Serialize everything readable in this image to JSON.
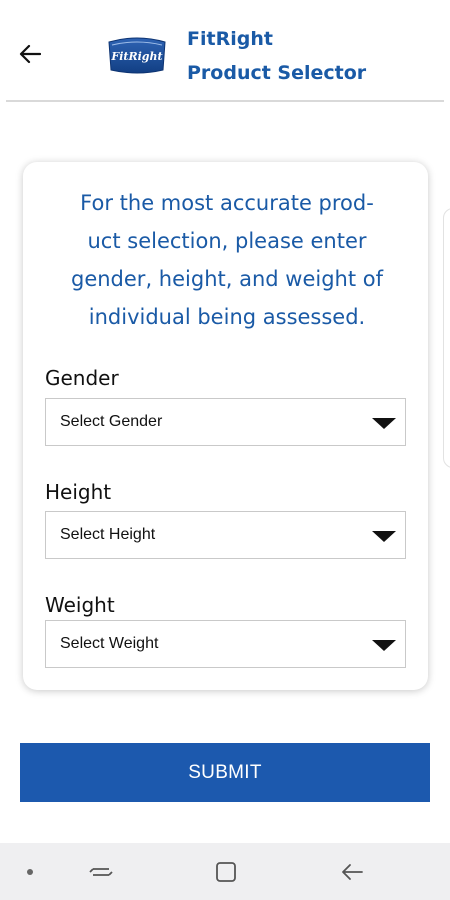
{
  "header": {
    "title_line1": "FitRight",
    "title_line2": "Product Selector",
    "logo_text": "FitRight",
    "back_icon": "arrow-left-icon"
  },
  "card": {
    "intro_line1": "For the most accurate prod-",
    "intro_line2": "uct selection, please enter",
    "intro_line3": "gender, height, and weight of",
    "intro_line4": "individual being assessed.",
    "fields": [
      {
        "label": "Gender",
        "value": "Select Gender"
      },
      {
        "label": "Height",
        "value": "Select Height"
      },
      {
        "label": "Weight",
        "value": "Select Weight"
      }
    ]
  },
  "submit_label": "SUBMIT",
  "navbar": {
    "icons": [
      "dot-icon",
      "recent-apps-icon",
      "home-icon",
      "back-icon"
    ]
  },
  "colors": {
    "brand_blue": "#1a5aa6",
    "button_blue": "#1c59ae",
    "navbar_bg": "#efeff1"
  }
}
